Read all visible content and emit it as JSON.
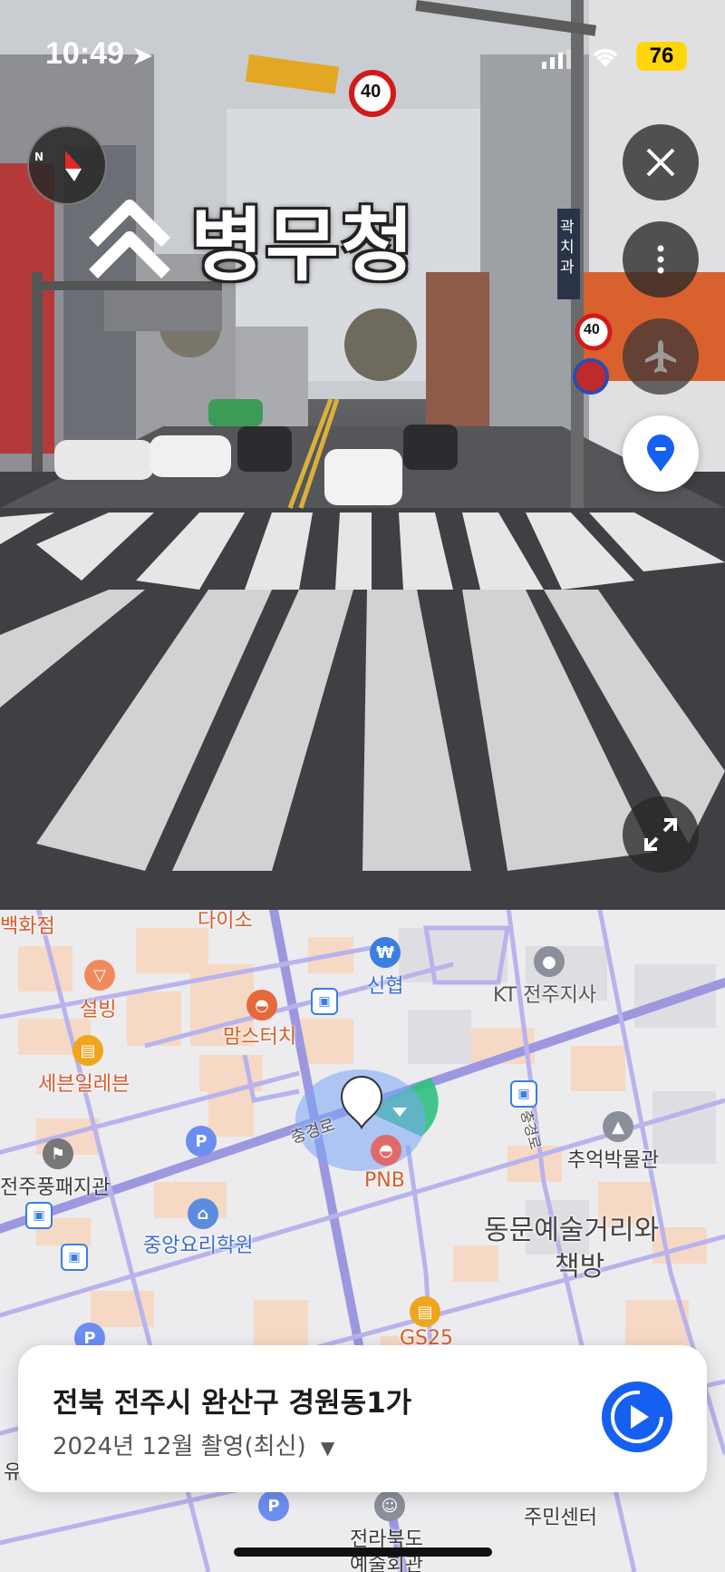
{
  "status_bar": {
    "time": "10:49",
    "battery": "76"
  },
  "street_view": {
    "location_sign": "병무청",
    "speed_limit_sign": "40",
    "side_speed_sign": "40",
    "side_sign_text": "곽치과"
  },
  "buttons": {
    "close": "close",
    "more": "more",
    "airplane": "airplane",
    "my_location": "location",
    "expand": "expand",
    "compass": "N"
  },
  "map": {
    "labels": {
      "top_left": "백화점",
      "daiso": "다이소",
      "shinhyup": "신협",
      "kt": "KT 전주지사",
      "seolbing": "설빙",
      "momstouch": "맘스터치",
      "seven_eleven": "세븐일레븐",
      "road": "충경로",
      "road_vertical": "충경로",
      "pnb": "PNB",
      "jeonju_pungpae": "전주풍패지관",
      "memory_museum": "추억박물관",
      "cooking_school": "중앙요리학원",
      "dongmun": "동문예술거리와",
      "chaekbang": "책방",
      "gs25": "GS25",
      "jeonbuk": "전라북도",
      "arts_hall": "예술회관",
      "community_center": "주민센터",
      "partial_left": "유"
    }
  },
  "card": {
    "address": "전북 전주시 완산구 경원동1가",
    "date": "2024년 12월 촬영(최신)",
    "play_label": "play"
  },
  "colors": {
    "accent": "#1560f0",
    "route": "#9b93e0",
    "battery": "#ffd60a"
  }
}
